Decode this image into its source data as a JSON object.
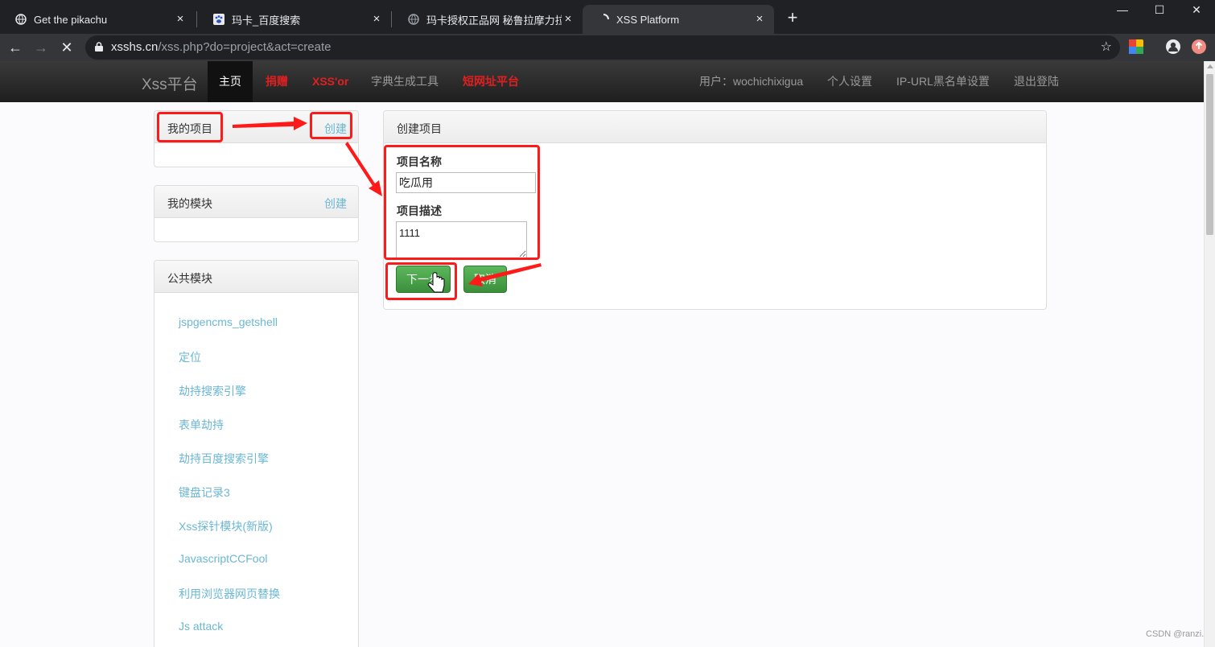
{
  "browser": {
    "tabs": [
      {
        "label": "Get the pikachu",
        "icon": "globe-icon"
      },
      {
        "label": "玛卡_百度搜索",
        "icon": "baidu-paw-icon"
      },
      {
        "label": "玛卡授权正品网 秘鲁拉摩力拉玛",
        "icon": "globe-icon"
      },
      {
        "label": "XSS Platform",
        "icon": "loading-icon"
      }
    ],
    "new_tab": "+",
    "url_host": "xsshs.cn",
    "url_path": "/xss.php?do=project&act=create"
  },
  "site": {
    "brand": "Xss平台",
    "nav": [
      {
        "label": "主页",
        "style": "active"
      },
      {
        "label": "捐赠",
        "style": "red"
      },
      {
        "label": "XSS'or",
        "style": "red"
      },
      {
        "label": "字典生成工具",
        "style": "normal"
      },
      {
        "label": "短网址平台",
        "style": "red"
      }
    ],
    "user_nav": [
      {
        "label": "用户：wochichixigua"
      },
      {
        "label": "个人设置"
      },
      {
        "label": "IP-URL黑名单设置"
      },
      {
        "label": "退出登陆"
      }
    ]
  },
  "sidebar": {
    "my_projects": {
      "title": "我的项目",
      "action": "创建"
    },
    "my_modules": {
      "title": "我的模块",
      "action": "创建"
    },
    "public_modules": {
      "title": "公共模块",
      "items": [
        "jspgencms_getshell",
        "定位",
        "劫持搜索引擎",
        "表单劫持",
        "劫持百度搜索引擎",
        "键盘记录3",
        "Xss探针模块(新版)",
        "JavascriptCCFool",
        "利用浏览器网页替换",
        "Js attack"
      ]
    }
  },
  "create_project": {
    "title": "创建项目",
    "name_label": "项目名称",
    "name_value": "吃瓜用",
    "desc_label": "项目描述",
    "desc_value": "1111",
    "next_button": "下一步",
    "cancel_button": "取消"
  },
  "watermark": "CSDN @ranzi.",
  "colors": {
    "link": "#6bb7d4",
    "nav_red": "#e02020",
    "button_green": "#4cae4c",
    "annotation_red": "#ff1a1a"
  }
}
